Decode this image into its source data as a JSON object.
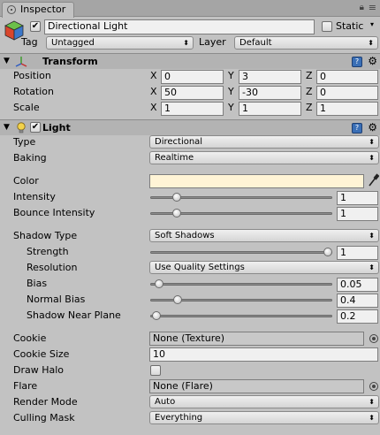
{
  "window": {
    "tab_title": "Inspector"
  },
  "header": {
    "object_name": "Directional Light",
    "static_label": "Static",
    "tag_label": "Tag",
    "tag_value": "Untagged",
    "layer_label": "Layer",
    "layer_value": "Default"
  },
  "transform": {
    "title": "Transform",
    "position_label": "Position",
    "rotation_label": "Rotation",
    "scale_label": "Scale",
    "axis_x": "X",
    "axis_y": "Y",
    "axis_z": "Z",
    "position": {
      "x": "0",
      "y": "3",
      "z": "0"
    },
    "rotation": {
      "x": "50",
      "y": "-30",
      "z": "0"
    },
    "scale": {
      "x": "1",
      "y": "1",
      "z": "1"
    }
  },
  "light": {
    "title": "Light",
    "type_label": "Type",
    "type_value": "Directional",
    "baking_label": "Baking",
    "baking_value": "Realtime",
    "color_label": "Color",
    "color_value": "#fff4d6",
    "intensity_label": "Intensity",
    "intensity_value": "1",
    "intensity_fraction": 0.125,
    "bounce_label": "Bounce Intensity",
    "bounce_value": "1",
    "bounce_fraction": 0.125,
    "shadow_type_label": "Shadow Type",
    "shadow_type_value": "Soft Shadows",
    "strength_label": "Strength",
    "strength_value": "1",
    "strength_fraction": 1.0,
    "resolution_label": "Resolution",
    "resolution_value": "Use Quality Settings",
    "bias_label": "Bias",
    "bias_value": "0.05",
    "bias_fraction": 0.025,
    "normal_bias_label": "Normal Bias",
    "normal_bias_value": "0.4",
    "normal_bias_fraction": 0.133,
    "near_plane_label": "Shadow Near Plane",
    "near_plane_value": "0.2",
    "near_plane_fraction": 0.01,
    "cookie_label": "Cookie",
    "cookie_value": "None (Texture)",
    "cookie_size_label": "Cookie Size",
    "cookie_size_value": "10",
    "draw_halo_label": "Draw Halo",
    "flare_label": "Flare",
    "flare_value": "None (Flare)",
    "render_mode_label": "Render Mode",
    "render_mode_value": "Auto",
    "culling_mask_label": "Culling Mask",
    "culling_mask_value": "Everything"
  },
  "icons": {
    "tab": "inspector-icon",
    "lock": "lock-icon",
    "menu": "menu-icon",
    "gameobject": "gameobject-cube-icon",
    "transform": "transform-axes-icon",
    "light": "light-bulb-icon",
    "help": "help-book-icon",
    "settings": "gear-icon",
    "picker": "eyedropper-icon",
    "object_picker": "object-picker-icon"
  }
}
